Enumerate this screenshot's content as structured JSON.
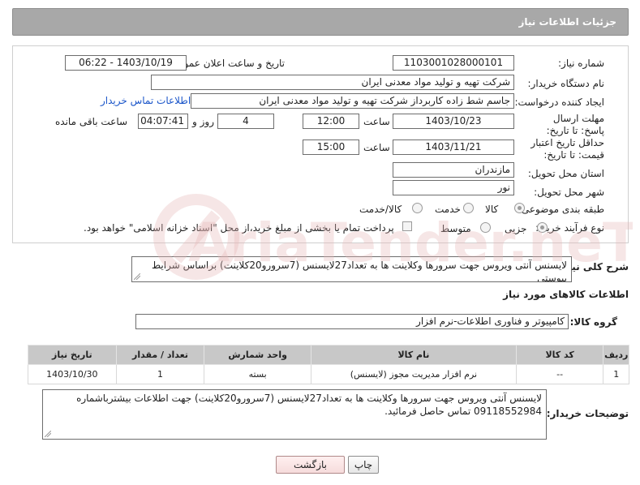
{
  "header": {
    "title": "جزئیات اطلاعات نیاز"
  },
  "form": {
    "need_number_label": "شماره نیاز:",
    "need_number": "1103001028000101",
    "announce_label": "تاریخ و ساعت اعلان عمومی:",
    "announce_value": "1403/10/19 - 06:22",
    "buyer_org_label": "نام دستگاه خریدار:",
    "buyer_org": "شرکت تهیه و تولید مواد معدنی ایران",
    "requester_label": "ایجاد کننده درخواست:",
    "requester": "جاسم شط زاده کاربرداز شرکت تهیه و تولید مواد معدنی ایران",
    "contact_link": "اطلاعات تماس خریدار",
    "deadline_label": "مهلت ارسال پاسخ: تا تاریخ:",
    "deadline_date": "1403/10/23",
    "deadline_time_label": "ساعت",
    "deadline_time": "12:00",
    "days_value": "4",
    "days_label": "روز و",
    "remaining_time": "04:07:41",
    "remaining_label": "ساعت باقی مانده",
    "validity_label": "حداقل تاریخ اعتبار قیمت: تا تاریخ:",
    "validity_date": "1403/11/21",
    "validity_time_label": "ساعت",
    "validity_time": "15:00",
    "province_label": "استان محل تحویل:",
    "province": "مازندران",
    "city_label": "شهر محل تحویل:",
    "city": "نور",
    "category_label": "طبقه بندی موضوعی:",
    "category_options": [
      "کالا",
      "خدمت",
      "کالا/خدمت"
    ],
    "process_label": "نوع فرآیند خرید :",
    "process_options": [
      "جزیی",
      "متوسط"
    ],
    "payment_note": "پرداخت تمام یا بخشی از مبلغ خرید،از محل \"اسناد خزانه اسلامی\" خواهد بود."
  },
  "summary": {
    "label": "شرح کلی نیاز:",
    "text": "لایسنس آنتی ویروس جهت سرورها وکلاینت ها به تعداد27لایسنس (7سرورو20کلاینت) براساس شرایط پیوستی"
  },
  "goods_info": {
    "title": "اطلاعات کالاهای مورد نیاز",
    "group_label": "گروه کالا:",
    "group_value": "کامپیوتر و فناوری اطلاعات-نرم افزار",
    "columns": [
      "ردیف",
      "کد کالا",
      "نام کالا",
      "واحد شمارش",
      "تعداد / مقدار",
      "تاریخ نیاز"
    ],
    "rows": [
      {
        "row": "1",
        "code": "--",
        "name": "نرم افزار مدیریت مجوز (لایسنس)",
        "unit": "بسته",
        "qty": "1",
        "date": "1403/10/30"
      }
    ]
  },
  "buyer_notes": {
    "label": "توضیحات خریدار:",
    "text": "لایسنس آنتی ویروس جهت سرورها وکلاینت ها به تعداد27لایسنس (7سرورو20کلاینت) جهت اطلاعات بیشترباشماره 09118552984 تماس حاصل فرمائید."
  },
  "buttons": {
    "print": "چاپ",
    "back": "بازگشت"
  },
  "watermark": {
    "text": "AriaTender.neT"
  },
  "colors": {
    "header_bg": "#a8a8a8",
    "link": "#1a55c9",
    "table_header": "#c8c8c8",
    "watermark": "#e6b8b8"
  }
}
